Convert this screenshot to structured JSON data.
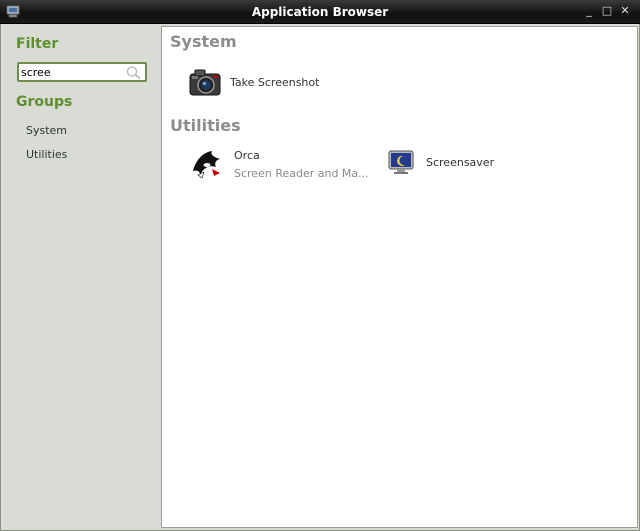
{
  "window": {
    "title": "Application Browser",
    "icons": {
      "app": "computer-icon",
      "minimize": "minimize-icon",
      "maximize": "maximize-icon",
      "close": "close-icon"
    }
  },
  "sidebar": {
    "filter_heading": "Filter",
    "search": {
      "value": "scree",
      "placeholder": ""
    },
    "groups_heading": "Groups",
    "groups": [
      {
        "label": "System"
      },
      {
        "label": "Utilities"
      }
    ]
  },
  "main": {
    "categories": [
      {
        "heading": "System",
        "apps": [
          {
            "name": "Take Screenshot",
            "icon": "camera-icon"
          }
        ]
      },
      {
        "heading": "Utilities",
        "apps": [
          {
            "name": "Orca",
            "description": "Screen Reader and Ma...",
            "icon": "orca-icon"
          },
          {
            "name": "Screensaver",
            "icon": "screensaver-monitor-icon"
          }
        ]
      }
    ]
  },
  "colors": {
    "heading_green": "#5e8d32",
    "category_gray": "#8c8c8c",
    "titlebar": "#1a1a1a",
    "sidebar_bg": "#d8dcd4"
  }
}
